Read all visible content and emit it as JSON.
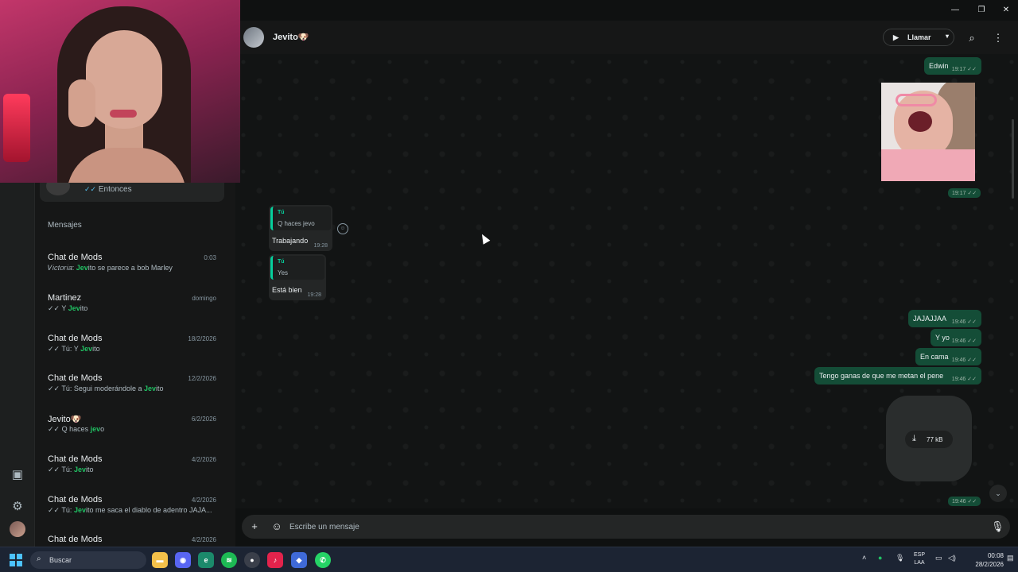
{
  "window": {
    "minimize": "—",
    "restore": "❐",
    "close": "✕"
  },
  "pinned_chat": {
    "preview": "Entonces"
  },
  "chat_list": {
    "section_label": "Mensajes",
    "items": [
      {
        "name": "Chat de Mods",
        "date": "0:03",
        "prefix": "𝑉𝑖𝑐𝑡𝑜𝑟𝑖𝑎: ",
        "highlight": "Jev",
        "rest": "ito se parece a bob Marley"
      },
      {
        "name": "Martinez",
        "date": "domingo",
        "prefix": "✓✓ Y ",
        "highlight": "Jev",
        "rest": "ito"
      },
      {
        "name": "Chat de Mods",
        "date": "18/2/2026",
        "prefix": "✓✓ Tú: Y ",
        "highlight": "Jev",
        "rest": "ito"
      },
      {
        "name": "Chat de Mods",
        "date": "12/2/2026",
        "prefix": "✓✓ Tú: Segui moderándole a ",
        "highlight": "Jev",
        "rest": "ito"
      },
      {
        "name": "Jevito🐶",
        "date": "6/2/2026",
        "prefix": "✓✓ Q haces ",
        "highlight": "jev",
        "rest": "o"
      },
      {
        "name": "Chat de Mods",
        "date": "4/2/2026",
        "prefix": "✓✓ Tú: ",
        "highlight": "Jev",
        "rest": "ito"
      },
      {
        "name": "Chat de Mods",
        "date": "4/2/2026",
        "prefix": "✓✓ Tú: ",
        "highlight": "Jev",
        "rest": "ito me saca el diablo de adentro JAJA..."
      },
      {
        "name": "Chat de Mods",
        "date": "4/2/2026",
        "prefix": "",
        "highlight": "",
        "rest": ""
      }
    ]
  },
  "header": {
    "contact_name": "Jevito🐶",
    "call_label": "Llamar"
  },
  "messages": {
    "edwin": {
      "text": "Edwin",
      "time": "19:17 ✓✓"
    },
    "sticker_time": "19:17 ✓✓",
    "reply1": {
      "quote_author": "Tú",
      "quote_text": "Q haces jevo",
      "text": "Trabajando",
      "time": "19:28"
    },
    "reply2": {
      "quote_author": "Tú",
      "quote_text": "Yes",
      "text": "Está bien",
      "time": "19:28"
    },
    "out1": {
      "text": "JAJAJJAA",
      "time": "19:46 ✓✓"
    },
    "out2": {
      "text": "Y yo",
      "time": "19:46 ✓✓"
    },
    "out3": {
      "text": "En cama",
      "time": "19:46 ✓✓"
    },
    "out4": {
      "text": "Tengo ganas de que me metan el pene",
      "time": "19:46 ✓✓"
    },
    "media": {
      "size": "77 kB",
      "time": "19:46 ✓✓"
    }
  },
  "composer": {
    "placeholder": "Escribe un mensaje"
  },
  "taskbar": {
    "search_label": "Buscar",
    "lang_top": "ESP",
    "lang_bottom": "LAA",
    "time": "00:08",
    "date": "28/2/2026"
  },
  "colors": {
    "accent": "#21c063",
    "outgoing_bubble": "#144d37",
    "incoming_bubble": "#242626",
    "read_tick": "#53bdeb"
  }
}
